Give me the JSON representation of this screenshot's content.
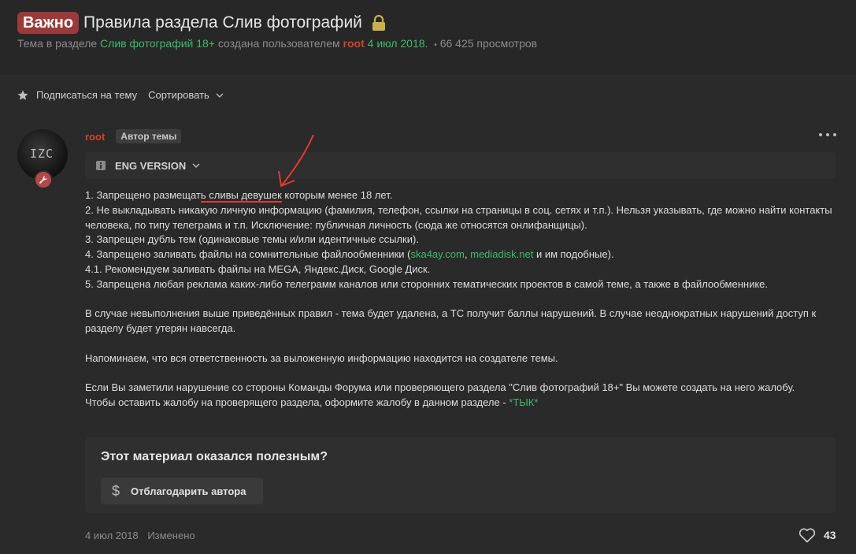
{
  "header": {
    "badge": "Важно",
    "title": "Правила раздела Слив фотографий",
    "meta_prefix": "Тема в разделе",
    "section": "Слив фотографий 18+",
    "created_by": "создана пользователем",
    "author": "root",
    "date": "4 июл 2018.",
    "separator": "•",
    "views": "66 425 просмотров"
  },
  "toolbar": {
    "subscribe": "Подписаться на тему",
    "sort": "Сортировать"
  },
  "post": {
    "avatar_text": "IZC",
    "author": "root",
    "author_tag": "Автор темы",
    "eng_version": "ENG VERSION",
    "rules": {
      "r1_pre": "1. Запрещено размещат",
      "r1_underlined": "ь сливы девушек",
      "r1_post": " которым менее 18 лет.",
      "r2": "2. Не выкладывать никакую личную информацию (фамилия, телефон, ссылки на страницы в соц. сетях и т.п.). Нельзя указывать, где можно найти контакты человека, по типу телеграма и т.п. Исключение: публичная личность (сюда же относятся онлифанщицы).",
      "r3": "3. Запрещен дубль тем (одинаковые темы и/или идентичные ссылки).",
      "r4_pre": "4. Запрещено заливать файлы на сомнительные файлообменники (",
      "r4_link1": "ska4ay.com",
      "r4_sep": ", ",
      "r4_link2": "mediadisk.net",
      "r4_post": " и им подобные).",
      "r41": "4.1. Рекомендуем заливать файлы на MEGA, Яндекс.Диск, Google Диск.",
      "r5": "5. Запрещена любая реклама каких-либо телеграмм каналов или сторонних тематических проектов в самой теме, а также в файлообменнике."
    },
    "violation": "В случае невыполнения выше приведённых правил - тема будет удалена, а ТС получит баллы нарушений. В случае неоднократных нарушений доступ к разделу будет утерян навсегда.",
    "responsibility": "Напоминаем, что вся ответственность за выложенную информацию находится на создателе темы.",
    "report_line1": "Если Вы заметили нарушение со стороны Команды Форума или проверяющего раздела \"Слив фотографий 18+\" Вы можете создать на него жалобу.",
    "report_line2": "Чтобы оставить жалобу на проверящего раздела, оформите жалобу в данном разделе - ",
    "report_link": "*ТЫК*",
    "useful_title": "Этот материал оказался полезным?",
    "thank_button": "Отблагодарить автора",
    "date": "4 июл 2018",
    "edited": "Изменено",
    "likes": "43"
  },
  "colors": {
    "accent_green": "#3dba6c",
    "badge_red": "#9b3a3a",
    "username_red": "#d6422c",
    "annotation_red": "#e53a2f"
  }
}
